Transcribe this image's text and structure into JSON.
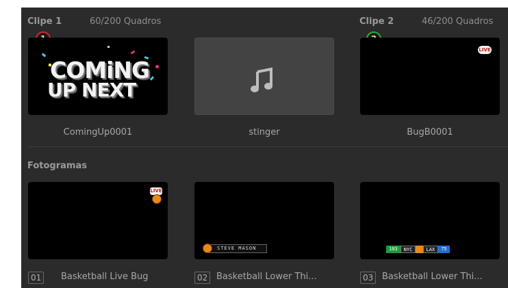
{
  "clip1": {
    "label": "Clipe 1",
    "frames": "60/200 Quadros",
    "badge": "1",
    "badge_color": "#d8252b",
    "thumbs": [
      {
        "caption": "ComingUp0001",
        "graphic_line1": "COMiNG",
        "graphic_line2": "UP NEXT"
      },
      {
        "caption": "stinger",
        "icon": "music-note-icon"
      }
    ]
  },
  "clip2": {
    "label": "Clipe 2",
    "frames": "46/200 Quadros",
    "badge": "2",
    "badge_color": "#27b52f",
    "thumb": {
      "caption": "BugB0001",
      "live_text": "LIVE"
    }
  },
  "stills": {
    "title": "Fotogramas",
    "items": [
      {
        "index": "01",
        "name": "Basketball Live Bug",
        "live_text": "LIVE"
      },
      {
        "index": "02",
        "name": "Basketball Lower Thi...",
        "lower_third_text": "STEVE MASON"
      },
      {
        "index": "03",
        "name": "Basketball Lower Thi...",
        "score_home": "103",
        "team_home": "NYC",
        "team_away": "LAX",
        "score_away": "75"
      }
    ]
  }
}
